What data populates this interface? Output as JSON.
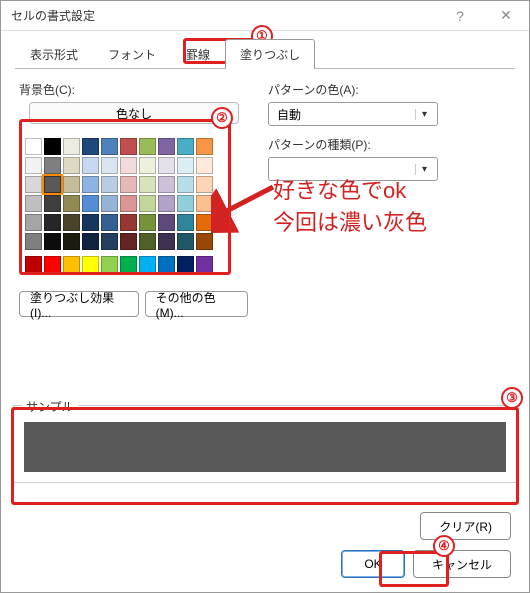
{
  "dialog": {
    "title": "セルの書式設定"
  },
  "tabs": {
    "t0": "表示形式",
    "t1": "フォント",
    "t2": "罫線",
    "t3": "塗りつぶし"
  },
  "labels": {
    "bgcolor": "背景色(C):",
    "nocolor": "色なし",
    "patternColor": "パターンの色(A):",
    "auto": "自動",
    "patternType": "パターンの種類(P):"
  },
  "buttons": {
    "fillEffects": "塗りつぶし効果(I)...",
    "otherColors": "その他の色(M)...",
    "clear": "クリア(R)",
    "ok": "OK",
    "cancel": "キャンセル"
  },
  "sample": {
    "legend": "サンプル",
    "color": "#595959"
  },
  "annotation": {
    "l1": "好きな色でok",
    "l2": "今回は濃い灰色"
  },
  "nums": {
    "n1": "①",
    "n2": "②",
    "n3": "③",
    "n4": "④"
  },
  "palette": {
    "rows": [
      [
        "#ffffff",
        "#000000",
        "#eeece1",
        "#1f497d",
        "#4f81bd",
        "#c0504d",
        "#9bbb59",
        "#8064a2",
        "#4bacc6",
        "#f79646"
      ],
      [
        "#f2f2f2",
        "#7f7f7f",
        "#ddd9c3",
        "#c6d9f0",
        "#dbe5f1",
        "#f2dcdb",
        "#ebf1dd",
        "#e5e0ec",
        "#dbeef3",
        "#fdeada"
      ],
      [
        "#d8d8d8",
        "#595959",
        "#c4bd97",
        "#8db3e2",
        "#b8cce4",
        "#e5b9b7",
        "#d7e3bc",
        "#ccc1d9",
        "#b7dde8",
        "#fbd5b5"
      ],
      [
        "#bfbfbf",
        "#3f3f3f",
        "#938953",
        "#548dd4",
        "#95b3d7",
        "#d99694",
        "#c3d69b",
        "#b2a2c7",
        "#92cddc",
        "#fac08f"
      ],
      [
        "#a5a5a5",
        "#262626",
        "#494429",
        "#17365d",
        "#366092",
        "#953734",
        "#76923c",
        "#5f497a",
        "#31859b",
        "#e36c09"
      ],
      [
        "#7f7f7f",
        "#0c0c0c",
        "#1d1b10",
        "#0f243e",
        "#244061",
        "#632423",
        "#4f6128",
        "#3f3151",
        "#205867",
        "#974806"
      ]
    ],
    "std": [
      "#c00000",
      "#ff0000",
      "#ffc000",
      "#ffff00",
      "#92d050",
      "#00b050",
      "#00b0f0",
      "#0070c0",
      "#002060",
      "#7030a0"
    ],
    "selected": "#595959"
  }
}
